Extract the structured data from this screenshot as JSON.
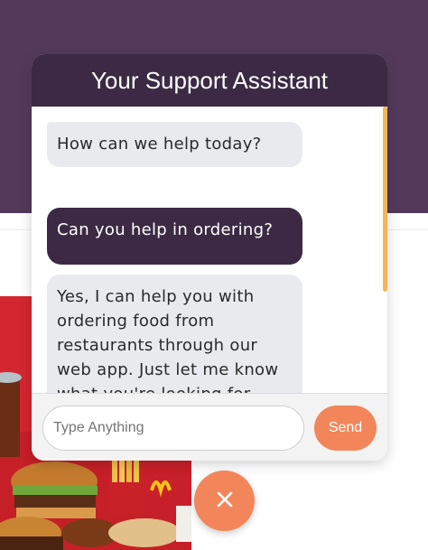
{
  "chat": {
    "title": "Your Support Assistant",
    "messages": [
      {
        "from": "bot",
        "text": "How can we help today?"
      },
      {
        "from": "user",
        "text": "Can you help in ordering?"
      },
      {
        "from": "bot",
        "text": "Yes, I can help you with ordering food from restaurants through our web app. Just let me know what you're looking for, and I can"
      }
    ],
    "input": {
      "value": "",
      "placeholder": "Type Anything"
    },
    "send_label": "Send"
  },
  "colors": {
    "header": "#3c2a45",
    "hero": "#533a5b",
    "accent": "#f2865a",
    "scrollbar": "#f4b554",
    "bot_bubble": "#e8eaed"
  },
  "icons": {
    "close": "close-icon"
  }
}
